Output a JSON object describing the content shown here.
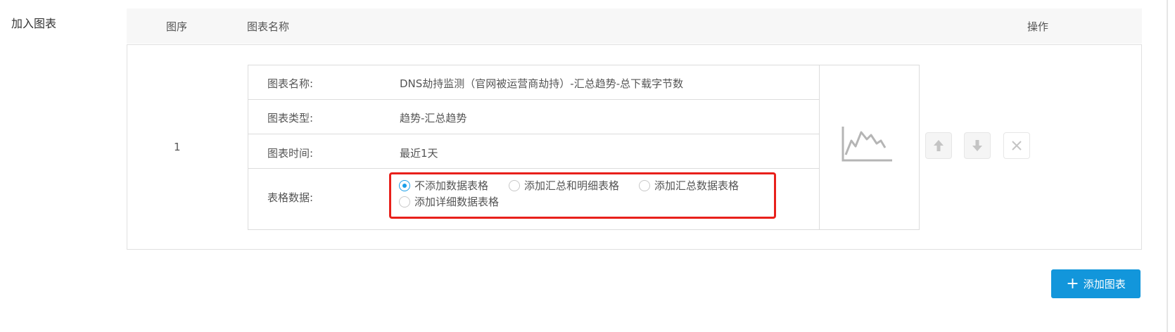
{
  "section": {
    "label": "加入图表"
  },
  "table": {
    "headers": {
      "order": "图序",
      "name": "图表名称",
      "ops": "操作"
    },
    "rows": [
      {
        "index": "1",
        "info": {
          "name_label": "图表名称:",
          "name_value": "DNS劫持监测（官网被运营商劫持）-汇总趋势-总下载字节数",
          "type_label": "图表类型:",
          "type_value": "趋势-汇总趋势",
          "time_label": "图表时间:",
          "time_value": "最近1天",
          "data_label": "表格数据:"
        },
        "radio_options": [
          {
            "label": "不添加数据表格",
            "checked": true
          },
          {
            "label": "添加汇总和明细表格",
            "checked": false
          },
          {
            "label": "添加汇总数据表格",
            "checked": false
          },
          {
            "label": "添加详细数据表格",
            "checked": false
          }
        ],
        "preview_icon": "line-chart-icon",
        "operations": [
          "arrow-up-icon",
          "arrow-down-icon",
          "close-icon"
        ]
      }
    ]
  },
  "add_button": {
    "label": "添加图表",
    "icon": "plus-icon"
  },
  "colors": {
    "accent": "#1296db",
    "radio_checked": "#1a9ee8",
    "highlight": "#e8201b"
  }
}
